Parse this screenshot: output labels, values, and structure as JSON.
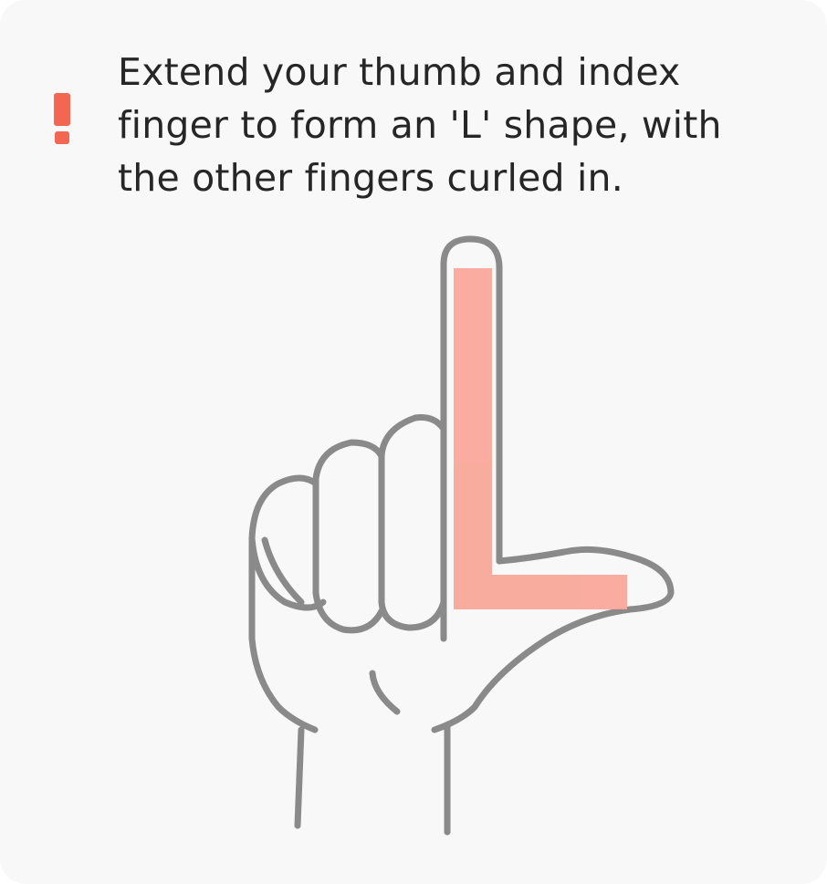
{
  "instruction": {
    "icon": "exclamation-icon",
    "text": "Extend your thumb and index finger to form an 'L' shape, with the other fingers curled in."
  },
  "illustration": {
    "subject": "hand-l-shape-icon",
    "highlight_color": "#f9a89a",
    "line_color": "#777777",
    "accent_color": "#f26652"
  }
}
